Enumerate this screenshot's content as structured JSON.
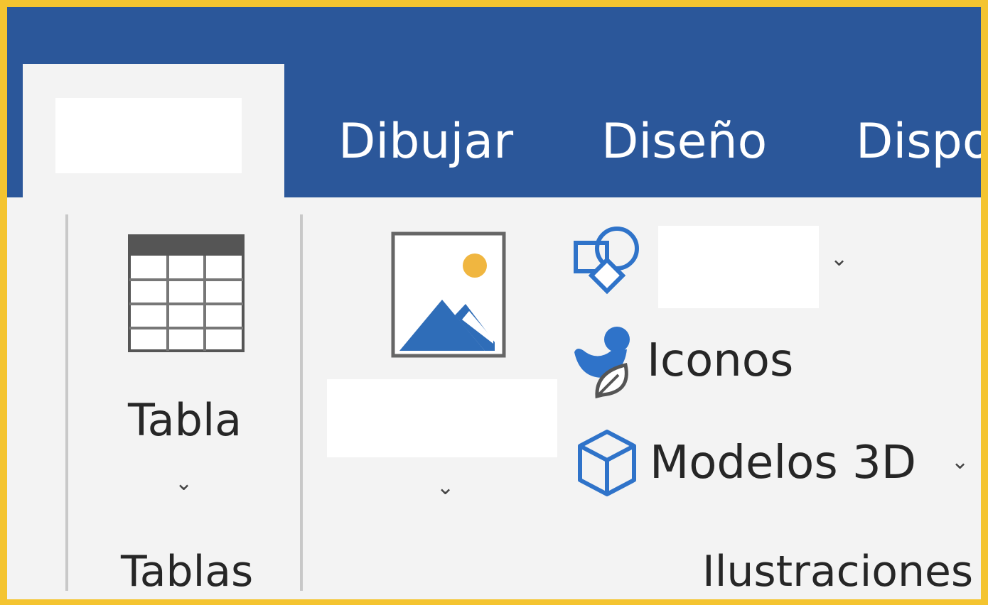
{
  "ribbon": {
    "tabs": [
      {
        "label": ""
      },
      {
        "label": "Dibujar"
      },
      {
        "label": "Diseño"
      },
      {
        "label": "Dispo"
      }
    ]
  },
  "groups": {
    "tables": {
      "button_label": "Tabla",
      "group_label": "Tablas",
      "chevron": "⌄",
      "icon": "table-icon"
    },
    "illustrations": {
      "group_label": "Ilustraciones",
      "image_button_label": "",
      "image_chevron": "⌄",
      "shapes_label": "",
      "shapes_chevron": "⌄",
      "icons_label": "Iconos",
      "models_label": "Modelos 3D",
      "models_chevron": "⌄",
      "icons": [
        "picture-icon",
        "shapes-icon",
        "icons-icon",
        "3d-model-icon"
      ]
    }
  },
  "colors": {
    "tab_bar": "#2b579a",
    "ribbon_bg": "#f3f3f3",
    "accent_blue": "#2f73c9",
    "border_frame": "#f4c430"
  }
}
